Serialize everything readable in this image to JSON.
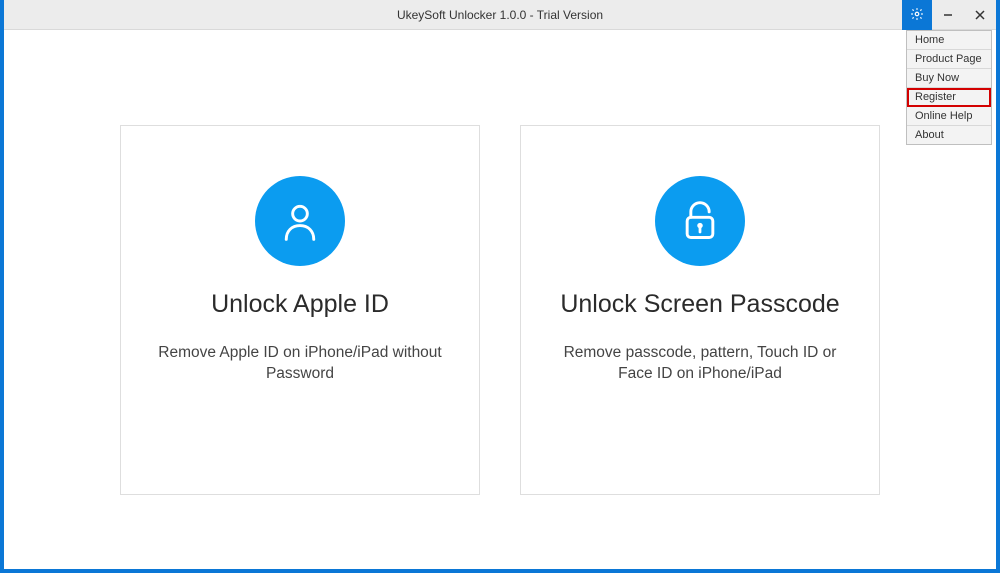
{
  "window": {
    "title": "UkeySoft Unlocker 1.0.0 - Trial Version"
  },
  "menu": {
    "items": [
      {
        "label": "Home",
        "highlighted": false
      },
      {
        "label": "Product Page",
        "highlighted": false
      },
      {
        "label": "Buy Now",
        "highlighted": false
      },
      {
        "label": "Register",
        "highlighted": true
      },
      {
        "label": "Online Help",
        "highlighted": false
      },
      {
        "label": "About",
        "highlighted": false
      }
    ]
  },
  "cards": {
    "appleId": {
      "title": "Unlock Apple ID",
      "desc": "Remove Apple ID on iPhone/iPad without Password"
    },
    "passcode": {
      "title": "Unlock Screen Passcode",
      "desc": "Remove passcode, pattern, Touch ID or Face ID on iPhone/iPad"
    }
  },
  "colors": {
    "accent": "#0b9cf0",
    "frame": "#0b77d6",
    "highlight": "#d30000"
  }
}
